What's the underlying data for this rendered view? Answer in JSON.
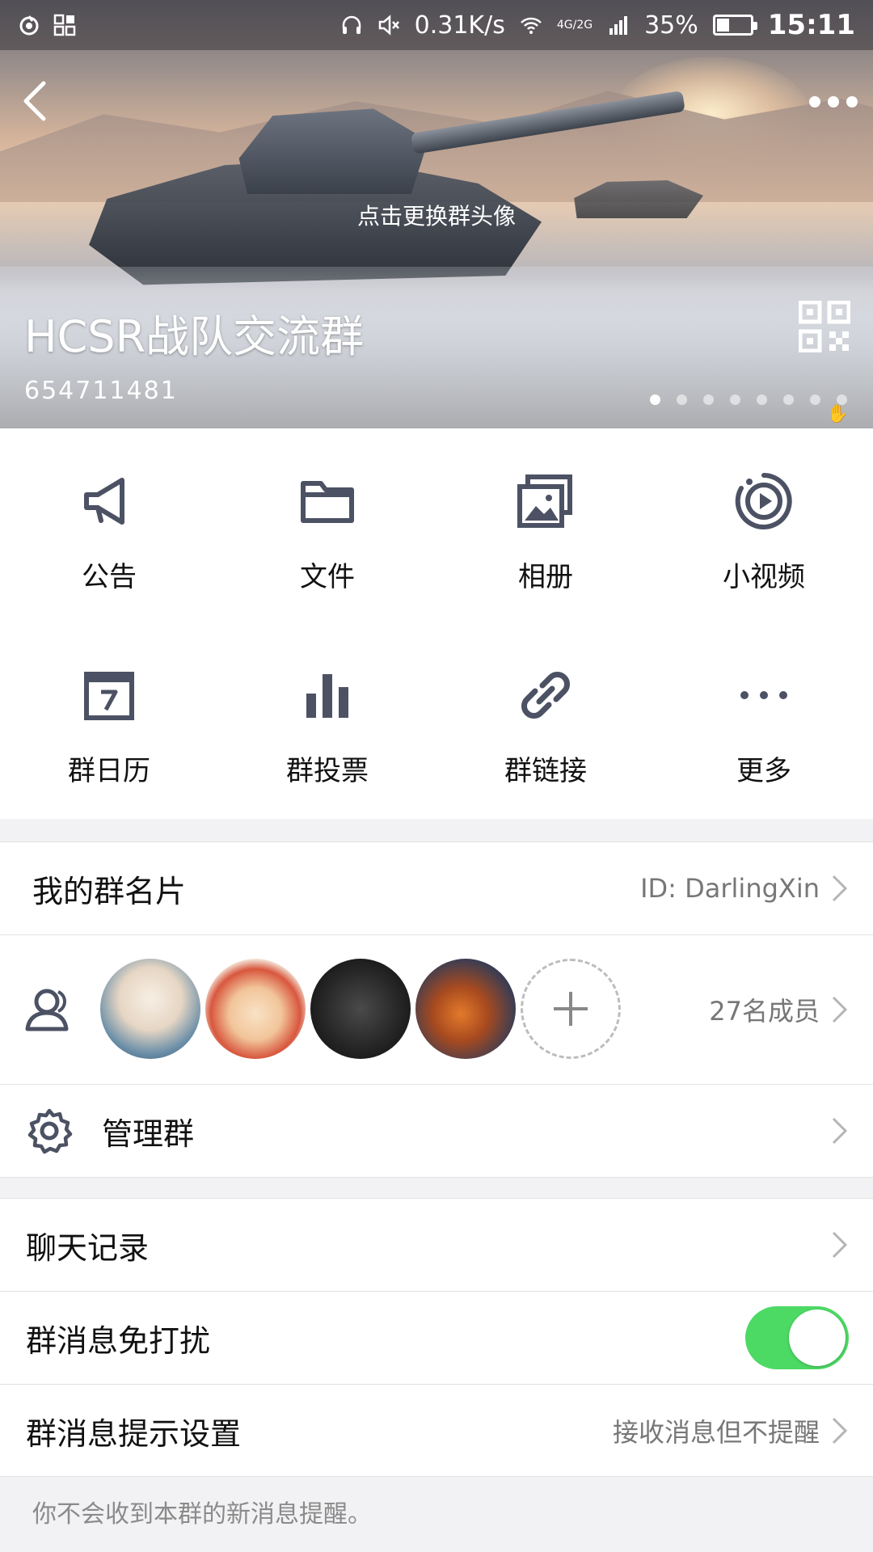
{
  "status_bar": {
    "network_speed": "0.31K/s",
    "network_type": "4G/2G",
    "battery": "35%",
    "time": "15:11"
  },
  "header": {
    "change_avatar_hint": "点击更换群头像",
    "group_name": "HCSR战队交流群",
    "group_id": "654711481",
    "carousel_pages": 8,
    "carousel_active_index": 0
  },
  "functions": [
    {
      "label": "公告",
      "icon": "megaphone-icon"
    },
    {
      "label": "文件",
      "icon": "folder-icon"
    },
    {
      "label": "相册",
      "icon": "album-icon"
    },
    {
      "label": "小视频",
      "icon": "video-icon"
    },
    {
      "label": "群日历",
      "icon": "calendar-icon"
    },
    {
      "label": "群投票",
      "icon": "bar-chart-icon"
    },
    {
      "label": "群链接",
      "icon": "link-icon"
    },
    {
      "label": "更多",
      "icon": "more-dots-icon"
    }
  ],
  "my_card": {
    "title": "我的群名片",
    "value": "ID: DarlingXin"
  },
  "members": {
    "count_text": "27名成员",
    "avatars": [
      "avatar-anime-boy",
      "avatar-anime-girls",
      "avatar-tank-dark",
      "avatar-tank-fire"
    ]
  },
  "manage": {
    "title": "管理群"
  },
  "chat_history": {
    "title": "聊天记录"
  },
  "do_not_disturb": {
    "title": "群消息免打扰",
    "enabled": true
  },
  "notify_settings": {
    "title": "群消息提示设置",
    "value": "接收消息但不提醒"
  },
  "footer_note": "你不会收到本群的新消息提醒。",
  "colors": {
    "icon_gray": "#4c5264",
    "toggle_on": "#4cd964",
    "divider": "#e2e2e6",
    "background": "#f2f2f4"
  }
}
